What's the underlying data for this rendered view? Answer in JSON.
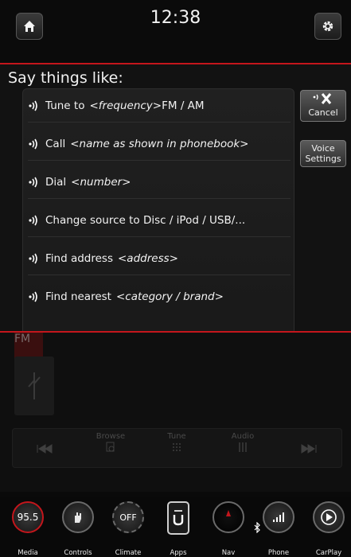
{
  "header": {
    "time": "12:38"
  },
  "voice": {
    "title": "Say things like:",
    "commands": [
      {
        "text": "Tune to",
        "param": "<frequency>",
        "suffix": " FM / AM"
      },
      {
        "text": "Call",
        "param": "<name as shown in phonebook>",
        "suffix": ""
      },
      {
        "text": "Dial",
        "param": "<number>",
        "suffix": ""
      },
      {
        "text": "Change source to Disc / iPod / USB/...",
        "param": "",
        "suffix": ""
      },
      {
        "text": "Find address",
        "param": "<address>",
        "suffix": ""
      },
      {
        "text": "Find nearest",
        "param": "<category / brand>",
        "suffix": ""
      }
    ],
    "cancel_label": "Cancel",
    "settings_label_line1": "Voice",
    "settings_label_line2": "Settings"
  },
  "background": {
    "band_label": "FM",
    "controls": [
      {
        "label": "",
        "icon": "prev-icon"
      },
      {
        "label": "Browse",
        "icon": "browse-icon"
      },
      {
        "label": "Tune",
        "icon": "tune-icon"
      },
      {
        "label": "Audio",
        "icon": "audio-icon"
      },
      {
        "label": "",
        "icon": "next-icon"
      }
    ]
  },
  "nav": {
    "items": [
      {
        "label": "Media",
        "value": "95.5"
      },
      {
        "label": "Controls",
        "value": ""
      },
      {
        "label": "Climate",
        "value": "OFF"
      },
      {
        "label": "Apps",
        "value": ""
      },
      {
        "label": "Nav",
        "value": ""
      },
      {
        "label": "Phone",
        "value": ""
      },
      {
        "label": "CarPlay",
        "value": ""
      }
    ]
  },
  "colors": {
    "accent_red": "#c4161c"
  }
}
